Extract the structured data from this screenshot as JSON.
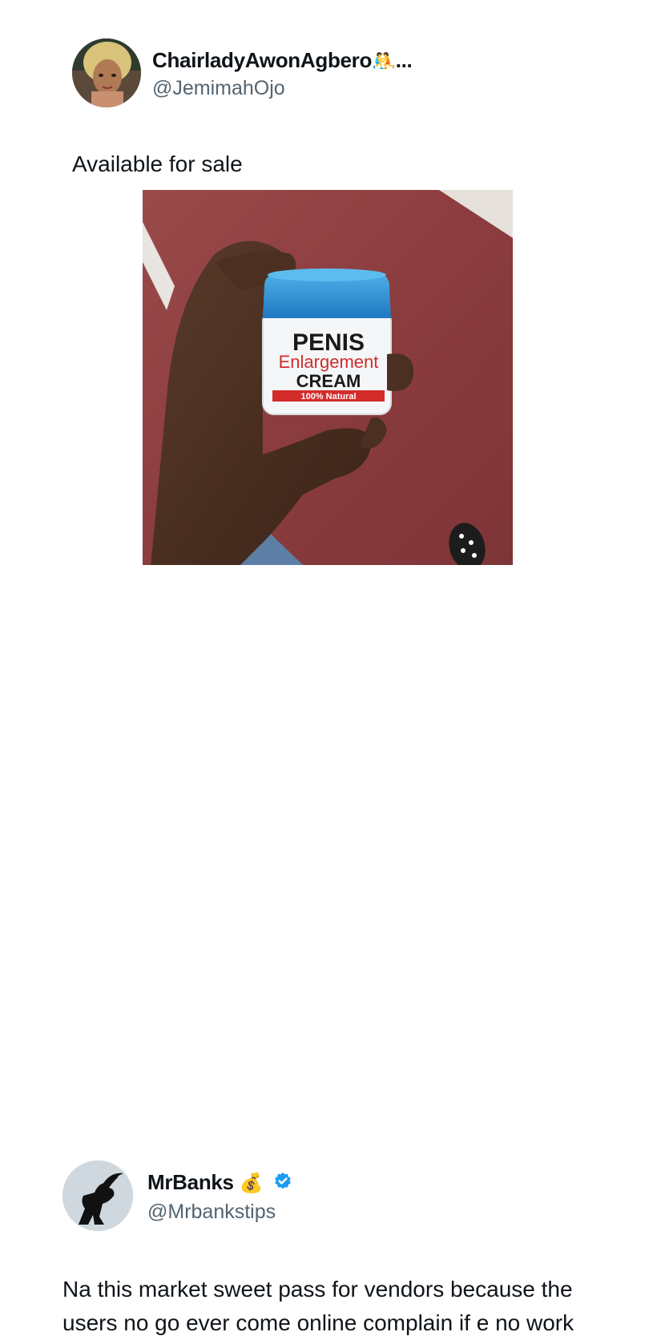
{
  "tweet1": {
    "display_name": "ChairladyAwonAgbero",
    "name_emoji": "🤼",
    "name_ellipsis": "...",
    "handle": "@JemimahOjo",
    "text": "Available for sale",
    "photo": {
      "jar_line1": "PENIS",
      "jar_line2": "Enlargement",
      "jar_line3": "CREAM",
      "jar_line4": "100% Natural"
    }
  },
  "tweet2": {
    "display_name": "MrBanks",
    "name_emoji": "💰",
    "verified": true,
    "handle": "@Mrbankstips",
    "text": "Na this market sweet pass for vendors because the users no go ever come online complain if e no work"
  },
  "colors": {
    "handle_gray": "#536471",
    "verified_blue": "#1d9bf0",
    "floor_red": "#8c3f3f",
    "lid_blue": "#2f8fd0",
    "label_red": "#d42b2b"
  }
}
